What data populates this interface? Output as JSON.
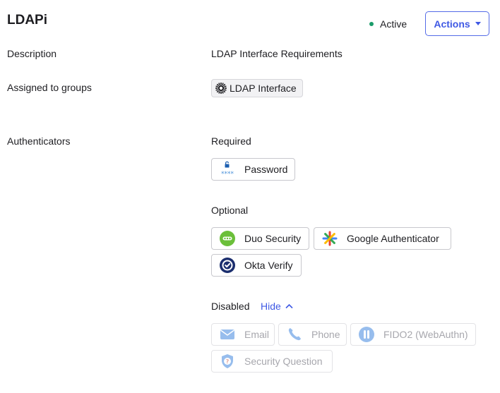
{
  "header": {
    "title": "LDAPi",
    "status": "Active",
    "status_color": "#1a9c6a",
    "actions_label": "Actions"
  },
  "details": {
    "description_label": "Description",
    "description_value": "LDAP Interface Requirements",
    "groups_label": "Assigned to groups",
    "group_name": "LDAP Interface",
    "authenticators_label": "Authenticators"
  },
  "authenticators": {
    "required_heading": "Required",
    "required": [
      {
        "name": "Password",
        "icon": "password-icon"
      }
    ],
    "optional_heading": "Optional",
    "optional": [
      {
        "name": "Duo Security",
        "icon": "duo-icon"
      },
      {
        "name": "Google Authenticator",
        "icon": "google-authenticator-icon"
      },
      {
        "name": "Okta Verify",
        "icon": "okta-verify-icon"
      }
    ],
    "disabled_heading": "Disabled",
    "hide_label": "Hide",
    "disabled": [
      {
        "name": "Email",
        "icon": "email-icon"
      },
      {
        "name": "Phone",
        "icon": "phone-icon"
      },
      {
        "name": "FIDO2 (WebAuthn)",
        "icon": "fido-icon"
      },
      {
        "name": "Security Question",
        "icon": "security-question-icon"
      }
    ]
  },
  "colors": {
    "accent": "#3f59e4",
    "text": "#1d1d21",
    "disabled_text": "#a7a7ad"
  }
}
